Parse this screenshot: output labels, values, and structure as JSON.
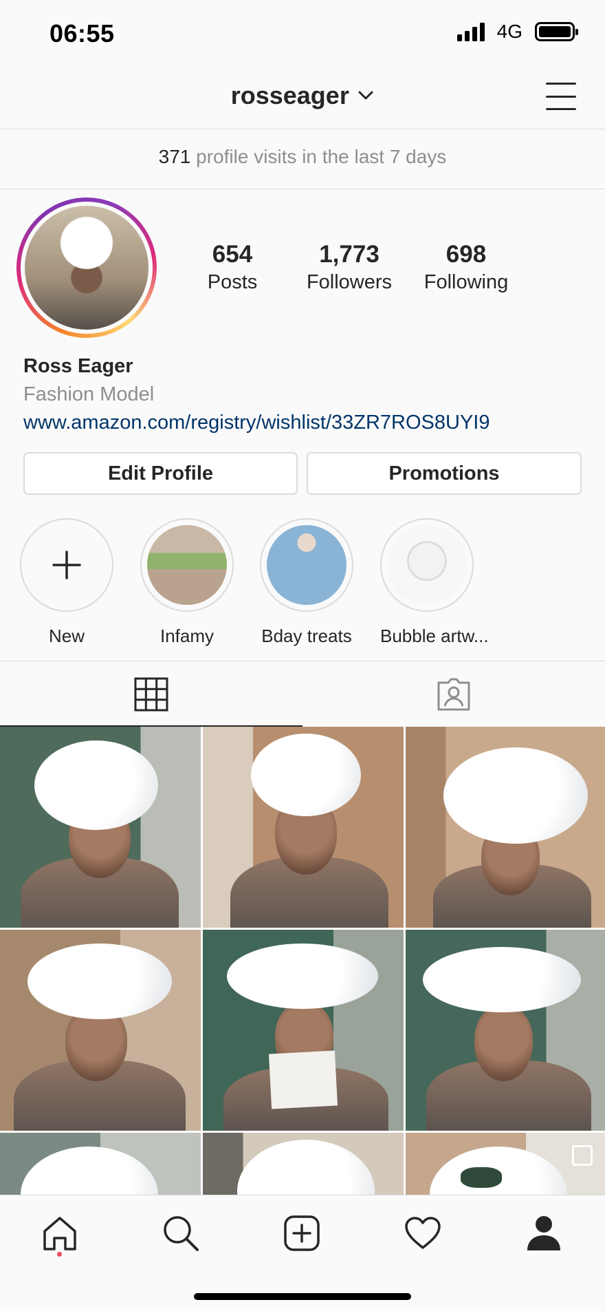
{
  "status_bar": {
    "time": "06:55",
    "network": "4G"
  },
  "header": {
    "username": "rosseager"
  },
  "visits": {
    "count": "371",
    "text": " profile visits in the last 7 days"
  },
  "profile": {
    "stats": [
      {
        "value": "654",
        "label": "Posts"
      },
      {
        "value": "1,773",
        "label": "Followers"
      },
      {
        "value": "698",
        "label": "Following"
      }
    ],
    "name": "Ross Eager",
    "category": "Fashion Model",
    "link": "www.amazon.com/registry/wishlist/33ZR7ROS8UYI9"
  },
  "buttons": {
    "edit_profile": "Edit Profile",
    "promotions": "Promotions"
  },
  "highlights": [
    {
      "label": "New"
    },
    {
      "label": "Infamy"
    },
    {
      "label": "Bday treats"
    },
    {
      "label": "Bubble artw..."
    }
  ],
  "grid": {
    "posts": [
      {
        "bg": "#5f7a6a"
      },
      {
        "bg": "#b89778"
      },
      {
        "bg": "#a88a6e"
      },
      {
        "bg": "#9c836a"
      },
      {
        "bg": "#4f6f62"
      },
      {
        "bg": "#5d7468"
      },
      {
        "bg": "#9fa49e"
      },
      {
        "bg": "#b8ab98"
      },
      {
        "bg": "#cfc6ba"
      }
    ]
  },
  "colors": {
    "link": "#003569",
    "secondary_text": "#8e8e8e",
    "notification_dot": "#ed4956"
  }
}
